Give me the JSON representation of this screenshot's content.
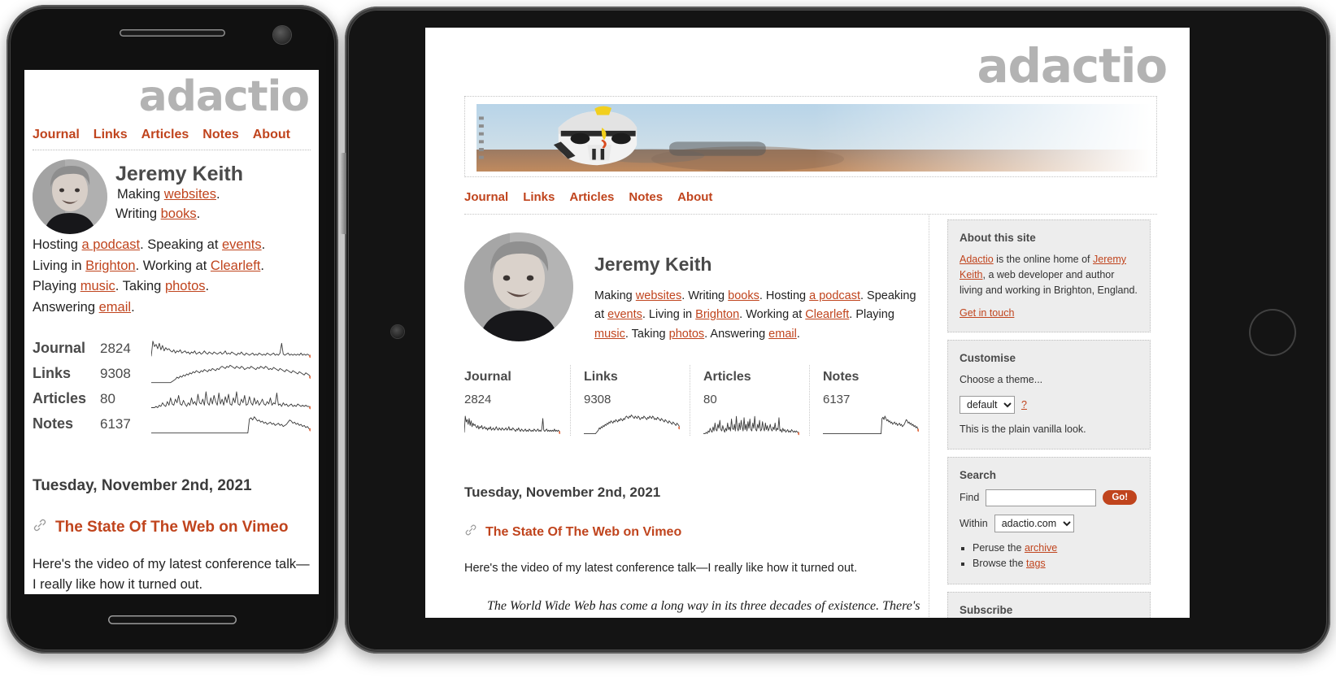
{
  "site": {
    "logo": "adactio",
    "nav": [
      {
        "label": "Journal"
      },
      {
        "label": "Links"
      },
      {
        "label": "Articles"
      },
      {
        "label": "Notes"
      },
      {
        "label": "About"
      }
    ],
    "profile": {
      "name": "Jeremy Keith",
      "bio_line1_pre": "Making ",
      "bio_websites": "websites",
      "bio_line1_mid": ". Writing ",
      "bio_books": "books",
      "bio_line1_mid2": ". Hosting ",
      "bio_podcast": "a podcast",
      "bio_line2_pre": ". Speaking at ",
      "bio_events": "events",
      "bio_line2_mid": ". Living in ",
      "bio_brighton": "Brighton",
      "bio_line2_mid2": ". Working at ",
      "bio_clearleft": "Clearleft",
      "bio_line3_pre": ". Playing ",
      "bio_music": "music",
      "bio_line3_mid": ". Taking ",
      "bio_photos": "photos",
      "bio_line3_mid2": ". Answering ",
      "bio_email": "email",
      "bio_end": "."
    },
    "stats": [
      {
        "label": "Journal",
        "count": "2824"
      },
      {
        "label": "Links",
        "count": "9308"
      },
      {
        "label": "Articles",
        "count": "80"
      },
      {
        "label": "Notes",
        "count": "6137"
      }
    ],
    "post": {
      "date": "Tuesday, November 2nd, 2021",
      "title": "The State Of The Web on Vimeo",
      "intro": "Here's the video of my latest conference talk—I really like how it turned out.",
      "quote": "The World Wide Web has come a long way in its three decades of existence. There's so much we can do now with HTML, CSS, and JavaScript: animation, layout, powerful APIs... we can even make websites that work offline! And yet"
    },
    "sidebar": {
      "about": {
        "heading": "About this site",
        "link_adactio": "Adactio",
        "text_a": " is the online home of ",
        "link_jeremy": "Jeremy Keith",
        "text_b": ", a web developer and author living and working in Brighton, England.",
        "get_in_touch": "Get in touch"
      },
      "customise": {
        "heading": "Customise",
        "choose_label": "Choose a theme...",
        "theme_value": "default",
        "theme_options": [
          "default"
        ],
        "help_label": "?",
        "description": "This is the plain vanilla look."
      },
      "search": {
        "heading": "Search",
        "find_label": "Find",
        "find_value": "",
        "find_placeholder": "",
        "go_label": "Go!",
        "within_label": "Within",
        "within_value": "adactio.com",
        "within_options": [
          "adactio.com"
        ],
        "links": [
          {
            "pre": "Peruse the ",
            "link": "archive"
          },
          {
            "pre": "Browse the ",
            "link": "tags"
          }
        ]
      },
      "subscribe": {
        "heading": "Subscribe"
      }
    },
    "colors": {
      "accent": "#c0441d",
      "logo_grey": "#b3b3b3",
      "text": "#222222",
      "panel_bg": "#ededed"
    },
    "icons": {
      "permalink": "link-icon",
      "chevron": "chevron-down-icon"
    }
  },
  "chart_data": [
    {
      "type": "line",
      "title": "Journal",
      "total": 2824,
      "values": [
        2,
        16,
        11,
        13,
        9,
        14,
        8,
        12,
        7,
        10,
        8,
        9,
        7,
        6,
        8,
        5,
        7,
        6,
        8,
        5,
        6,
        7,
        5,
        6,
        4,
        6,
        5,
        7,
        4,
        5,
        6,
        4,
        5,
        7,
        5,
        4,
        6,
        5,
        4,
        6,
        5,
        4,
        5,
        6,
        4,
        5,
        7,
        4,
        5,
        4,
        6,
        5,
        4,
        3,
        5,
        4,
        6,
        4,
        3,
        5,
        4,
        3,
        4,
        5,
        3,
        4,
        3,
        5,
        4,
        3,
        4,
        3,
        5,
        4,
        3,
        4,
        5,
        3,
        4,
        3,
        5,
        14,
        4,
        3,
        4,
        5,
        3,
        4,
        3,
        4,
        3,
        4,
        3,
        5,
        3,
        4,
        3,
        4,
        3,
        2
      ],
      "ylim": [
        0,
        18
      ]
    },
    {
      "type": "line",
      "title": "Links",
      "total": 9308,
      "values": [
        1,
        1,
        1,
        1,
        1,
        1,
        1,
        1,
        1,
        1,
        1,
        1,
        1,
        2,
        3,
        4,
        6,
        5,
        7,
        6,
        8,
        7,
        9,
        8,
        10,
        9,
        11,
        10,
        12,
        11,
        10,
        12,
        11,
        13,
        12,
        11,
        13,
        12,
        14,
        13,
        12,
        14,
        13,
        15,
        16,
        15,
        14,
        16,
        15,
        17,
        16,
        15,
        14,
        16,
        15,
        14,
        16,
        15,
        13,
        14,
        15,
        14,
        16,
        15,
        14,
        13,
        15,
        14,
        16,
        15,
        14,
        16,
        15,
        13,
        14,
        13,
        15,
        14,
        13,
        12,
        14,
        13,
        12,
        11,
        13,
        12,
        11,
        10,
        12,
        11,
        10,
        9,
        11,
        10,
        9,
        8,
        10,
        9,
        8,
        6
      ],
      "ylim": [
        0,
        18
      ]
    },
    {
      "type": "line",
      "title": "Articles",
      "total": 80,
      "values": [
        1,
        1,
        1,
        2,
        1,
        3,
        2,
        5,
        3,
        2,
        6,
        3,
        9,
        4,
        3,
        8,
        5,
        11,
        4,
        3,
        7,
        4,
        2,
        5,
        3,
        9,
        4,
        6,
        3,
        12,
        5,
        4,
        8,
        3,
        14,
        5,
        3,
        9,
        4,
        11,
        6,
        3,
        13,
        4,
        8,
        3,
        10,
        5,
        12,
        4,
        3,
        9,
        5,
        14,
        4,
        3,
        8,
        5,
        11,
        3,
        4,
        10,
        5,
        3,
        9,
        4,
        7,
        3,
        5,
        8,
        4,
        3,
        6,
        4,
        9,
        3,
        5,
        4,
        13,
        3,
        4,
        2,
        5,
        3,
        4,
        2,
        3,
        4,
        2,
        3,
        2,
        4,
        3,
        2,
        3,
        2,
        3,
        2,
        2,
        1
      ],
      "ylim": [
        0,
        16
      ]
    },
    {
      "type": "line",
      "title": "Notes",
      "total": 6137,
      "values": [
        1,
        1,
        1,
        1,
        1,
        1,
        1,
        1,
        1,
        1,
        1,
        1,
        1,
        1,
        1,
        1,
        1,
        1,
        1,
        1,
        1,
        1,
        1,
        1,
        1,
        1,
        1,
        1,
        1,
        1,
        1,
        1,
        1,
        1,
        1,
        1,
        1,
        1,
        1,
        1,
        1,
        1,
        1,
        1,
        1,
        1,
        1,
        1,
        1,
        1,
        1,
        1,
        1,
        1,
        1,
        1,
        1,
        1,
        1,
        1,
        1,
        14,
        15,
        13,
        16,
        14,
        12,
        13,
        11,
        12,
        10,
        11,
        9,
        10,
        11,
        9,
        10,
        8,
        9,
        10,
        8,
        9,
        7,
        8,
        9,
        11,
        13,
        12,
        10,
        11,
        9,
        10,
        8,
        9,
        7,
        8,
        6,
        7,
        5,
        4
      ],
      "ylim": [
        0,
        18
      ]
    }
  ]
}
